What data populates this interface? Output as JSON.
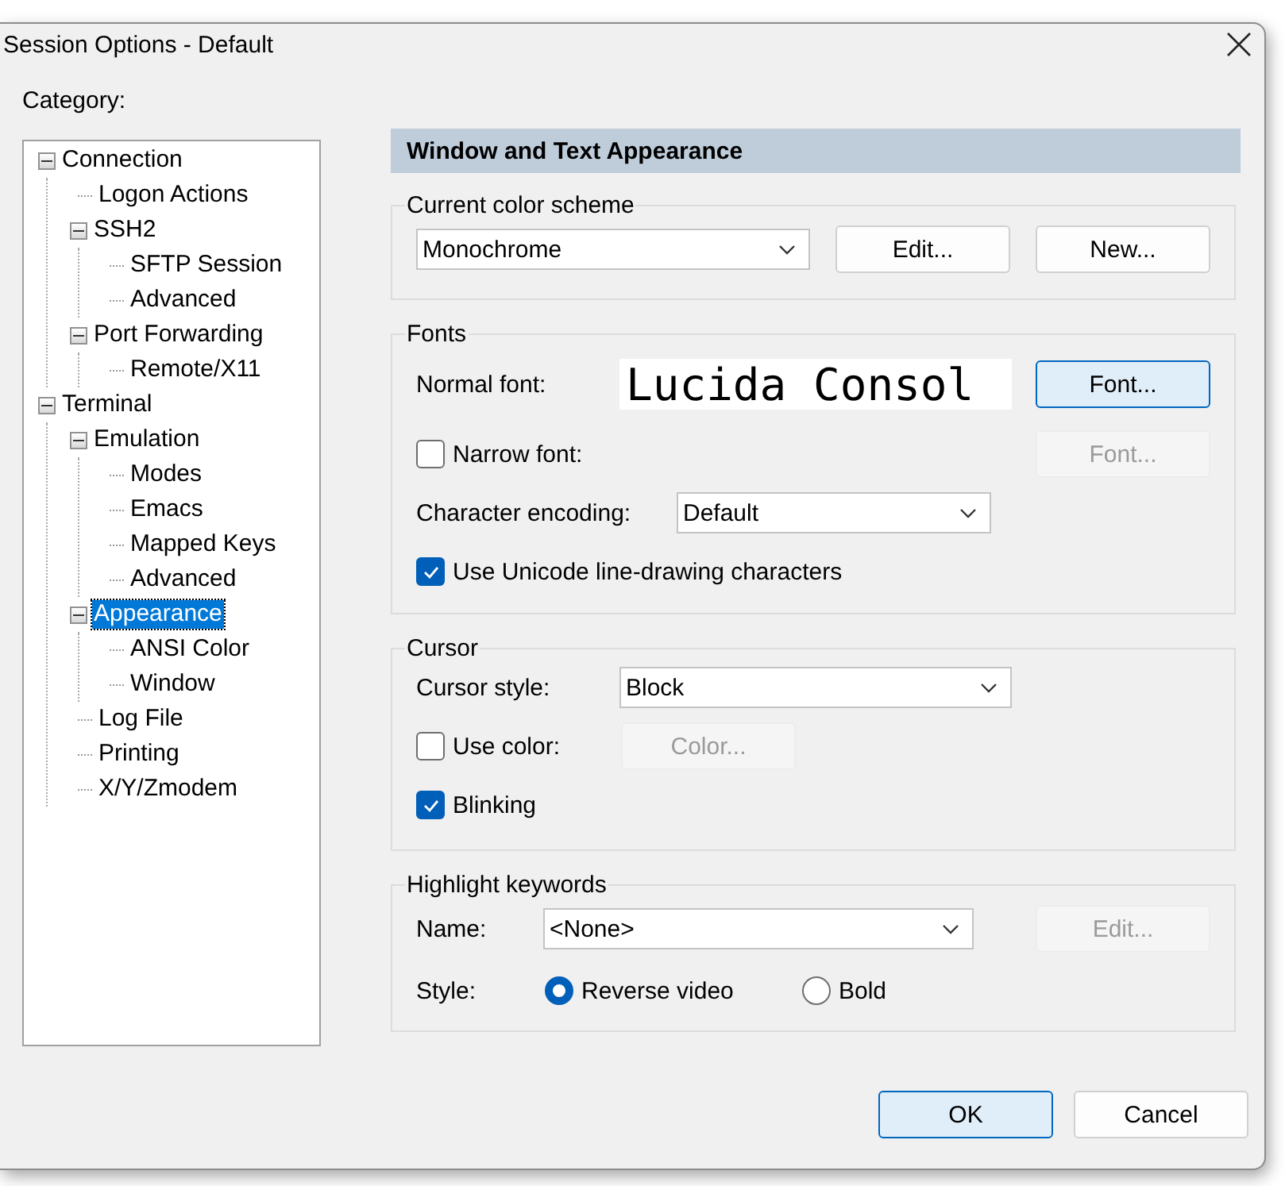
{
  "window": {
    "title": "Session Options - Default"
  },
  "category": {
    "label": "Category:",
    "tree": [
      {
        "label": "Connection",
        "expanded": true,
        "selected": false,
        "children": [
          {
            "label": "Logon Actions",
            "selected": false
          },
          {
            "label": "SSH2",
            "expanded": true,
            "selected": false,
            "children": [
              {
                "label": "SFTP Session",
                "selected": false
              },
              {
                "label": "Advanced",
                "selected": false
              }
            ]
          },
          {
            "label": "Port Forwarding",
            "expanded": true,
            "selected": false,
            "children": [
              {
                "label": "Remote/X11",
                "selected": false
              }
            ]
          }
        ]
      },
      {
        "label": "Terminal",
        "expanded": true,
        "selected": false,
        "children": [
          {
            "label": "Emulation",
            "expanded": true,
            "selected": false,
            "children": [
              {
                "label": "Modes",
                "selected": false
              },
              {
                "label": "Emacs",
                "selected": false
              },
              {
                "label": "Mapped Keys",
                "selected": false
              },
              {
                "label": "Advanced",
                "selected": false
              }
            ]
          },
          {
            "label": "Appearance",
            "expanded": true,
            "selected": true,
            "children": [
              {
                "label": "ANSI Color",
                "selected": false
              },
              {
                "label": "Window",
                "selected": false
              }
            ]
          },
          {
            "label": "Log File",
            "selected": false
          },
          {
            "label": "Printing",
            "selected": false
          },
          {
            "label": "X/Y/Zmodem",
            "selected": false
          }
        ]
      }
    ]
  },
  "panel": {
    "header": "Window and Text Appearance",
    "color_scheme": {
      "title": "Current color scheme",
      "value": "Monochrome",
      "buttons": [
        {
          "label": "Edit...",
          "disabled": false
        },
        {
          "label": "New...",
          "disabled": false
        }
      ]
    },
    "fonts": {
      "title": "Fonts",
      "normal_font": {
        "label": "Normal font:",
        "preview": "Lucida Consol",
        "button": {
          "label": "Font...",
          "disabled": false,
          "focused": true
        }
      },
      "narrow_font": {
        "label": "Narrow font:",
        "checked": false,
        "button": {
          "label": "Font...",
          "disabled": true
        }
      },
      "encoding": {
        "label": "Character encoding:",
        "value": "Default"
      },
      "line_drawing": {
        "label": "Use Unicode line-drawing characters",
        "checked": true
      }
    },
    "cursor": {
      "title": "Cursor",
      "style": {
        "label": "Cursor style:",
        "value": "Block"
      },
      "use_color": {
        "label": "Use color:",
        "checked": false,
        "button": {
          "label": "Color...",
          "disabled": true
        }
      },
      "blinking": {
        "label": "Blinking",
        "checked": true
      }
    },
    "highlight": {
      "title": "Highlight keywords",
      "name": {
        "label": "Name:",
        "value": "<None>",
        "button": {
          "label": "Edit...",
          "disabled": true
        }
      },
      "style": {
        "label": "Style:",
        "options": [
          {
            "label": "Reverse video",
            "selected": true
          },
          {
            "label": "Bold",
            "selected": false
          }
        ]
      }
    }
  },
  "footer": {
    "buttons": [
      {
        "label": "OK",
        "focused": true
      },
      {
        "label": "Cancel",
        "focused": false
      }
    ]
  }
}
